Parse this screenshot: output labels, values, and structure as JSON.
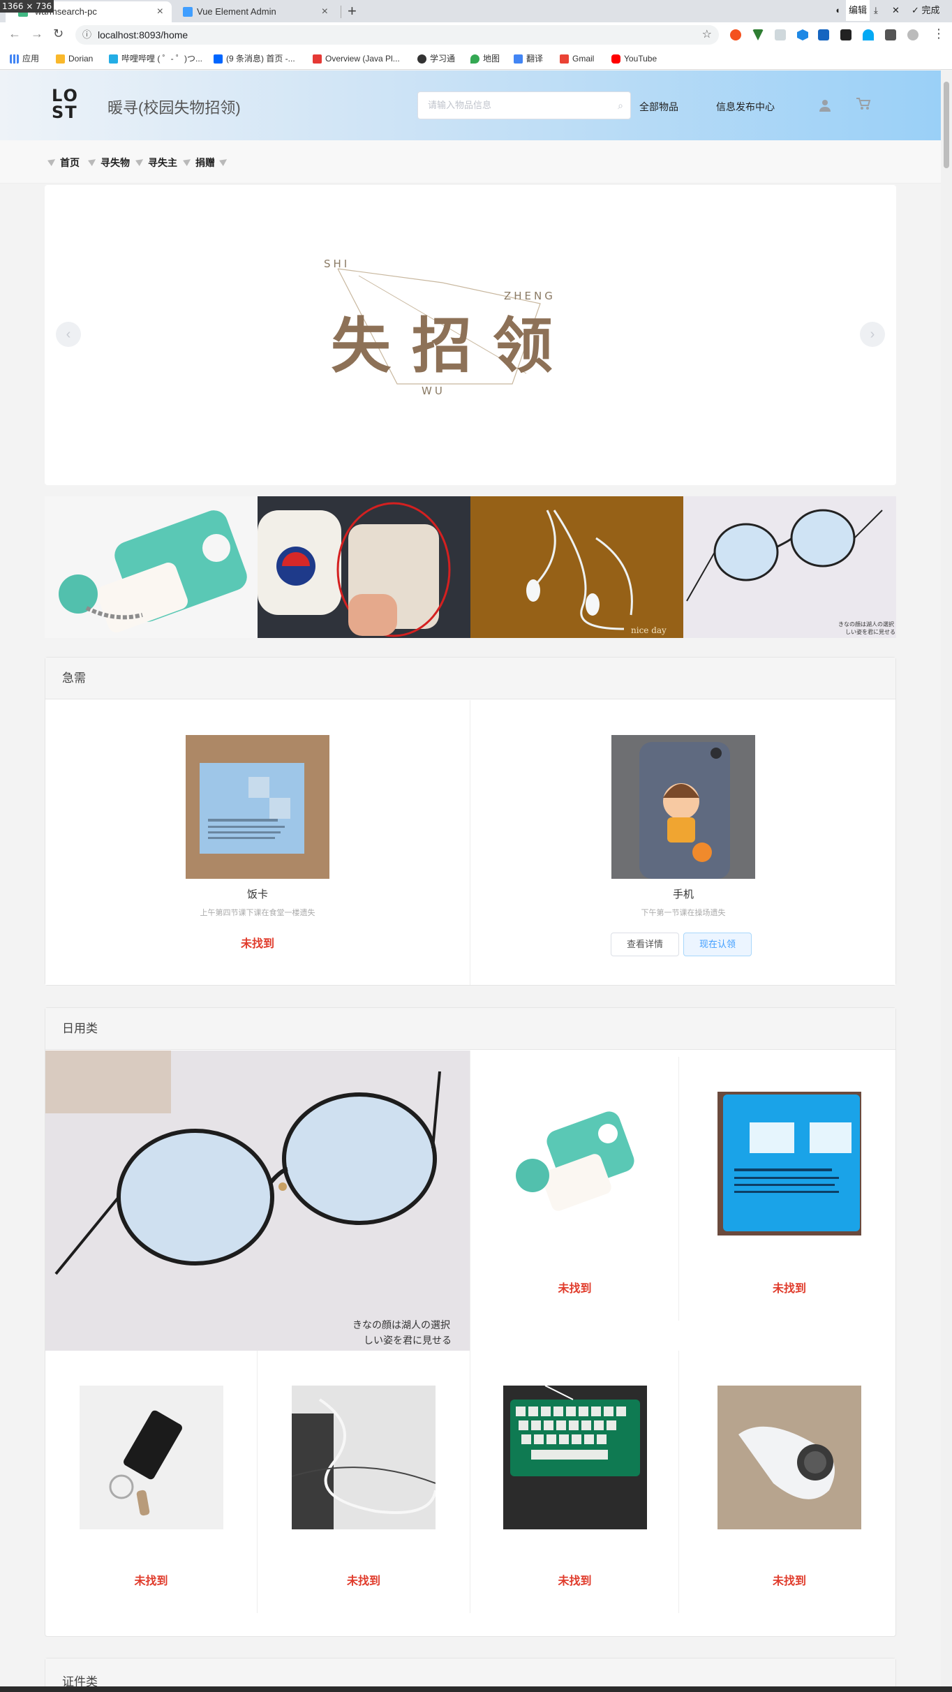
{
  "overlay": {
    "dimensions": "1366 × 736"
  },
  "browser": {
    "tabs": [
      {
        "title": "warmsearch-pc"
      },
      {
        "title": "Vue Element Admin"
      }
    ],
    "new_tab": "+",
    "window_controls": {
      "edit": "编辑",
      "done": "完成"
    },
    "url": "localhost:8093/home",
    "bookmarks": [
      {
        "label": "应用",
        "icon": "apps-grid-icon"
      },
      {
        "label": "Dorian",
        "icon": "folder-icon"
      },
      {
        "label": "哔哩哔哩 ( ゜- ゜)つ...",
        "icon": "bilibili-icon"
      },
      {
        "label": "(9 条消息) 首页 -...",
        "icon": "zhihu-icon"
      },
      {
        "label": "Overview (Java Pl...",
        "icon": "oracle-icon"
      },
      {
        "label": "学习通",
        "icon": "chaoxing-icon"
      },
      {
        "label": "地图",
        "icon": "maps-icon"
      },
      {
        "label": "翻译",
        "icon": "translate-icon"
      },
      {
        "label": "Gmail",
        "icon": "gmail-icon"
      },
      {
        "label": "YouTube",
        "icon": "youtube-icon"
      }
    ]
  },
  "header": {
    "logo_top": "LO",
    "logo_bottom": "ST",
    "title": "暖寻(校园失物招领)",
    "search_placeholder": "请输入物品信息",
    "nav": [
      "全部物品",
      "信息发布中心"
    ]
  },
  "breadcrumb": [
    "首页",
    "寻失物",
    "寻失主",
    "捐赠"
  ],
  "carousel": {
    "art_text": {
      "main": "失 招 领",
      "pinyin_shi": "SHI",
      "pinyin_zheng": "ZHENG",
      "pinyin_wu": "WU"
    },
    "prev": "‹",
    "next": "›"
  },
  "thumbnails": [
    "usb-drive-photo",
    "card-holder-photo",
    "earphones-photo",
    "glasses-photo"
  ],
  "thumb_captions": {
    "earphones": "nice day",
    "glasses_line1": "きなの顔は湖人の選択",
    "glasses_line2": "しい姿を君に見せる"
  },
  "urgent": {
    "title": "急需",
    "items": [
      {
        "name": "饭卡",
        "desc": "上午第四节课下课在食堂一楼遗失",
        "status": "未找到"
      },
      {
        "name": "手机",
        "desc": "下午第一节课在操场遗失",
        "buttons": {
          "detail": "查看详情",
          "claim": "现在认领"
        }
      }
    ]
  },
  "daily": {
    "title": "日用类",
    "feature_caption": {
      "line1": "きなの顔は湖人の選択",
      "line2": "しい姿を君に見せる"
    },
    "items": [
      {
        "photo": "usb-drive-photo",
        "status": "未找到"
      },
      {
        "photo": "blue-card-photo",
        "status": "未找到"
      },
      {
        "photo": "flash-drive-photo",
        "status": "未找到"
      },
      {
        "photo": "cable-photo",
        "status": "未找到"
      },
      {
        "photo": "keyboard-photo",
        "status": "未找到"
      },
      {
        "photo": "airpod-photo",
        "status": "未找到"
      }
    ]
  },
  "certificates": {
    "title": "证件类"
  }
}
